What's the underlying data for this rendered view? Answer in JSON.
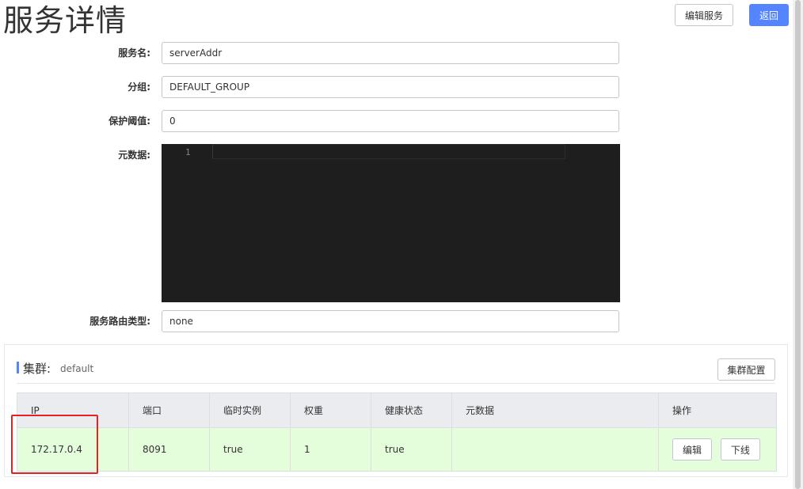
{
  "page": {
    "title": "服务详情",
    "edit_service_label": "编辑服务",
    "back_label": "返回"
  },
  "form": {
    "service_name_label": "服务名:",
    "service_name_value": "serverAddr",
    "group_label": "分组:",
    "group_value": "DEFAULT_GROUP",
    "protect_threshold_label": "保护阈值:",
    "protect_threshold_value": "0",
    "metadata_label": "元数据:",
    "metadata_line_number": "1",
    "router_type_label": "服务路由类型:",
    "router_type_value": "none"
  },
  "cluster": {
    "title": "集群:",
    "name": "default",
    "config_label": "集群配置",
    "columns": [
      "IP",
      "端口",
      "临时实例",
      "权重",
      "健康状态",
      "元数据",
      "操作"
    ],
    "rows": [
      {
        "ip": "172.17.0.4",
        "port": "8091",
        "ephemeral": "true",
        "weight": "1",
        "healthy": "true",
        "metadata": "",
        "edit_label": "编辑",
        "offline_label": "下线"
      }
    ]
  },
  "colors": {
    "primary": "#5584ff",
    "row_highlight": "#e4fdda",
    "annotation_box": "#e32323",
    "editor_bg": "#1e1e1e"
  }
}
